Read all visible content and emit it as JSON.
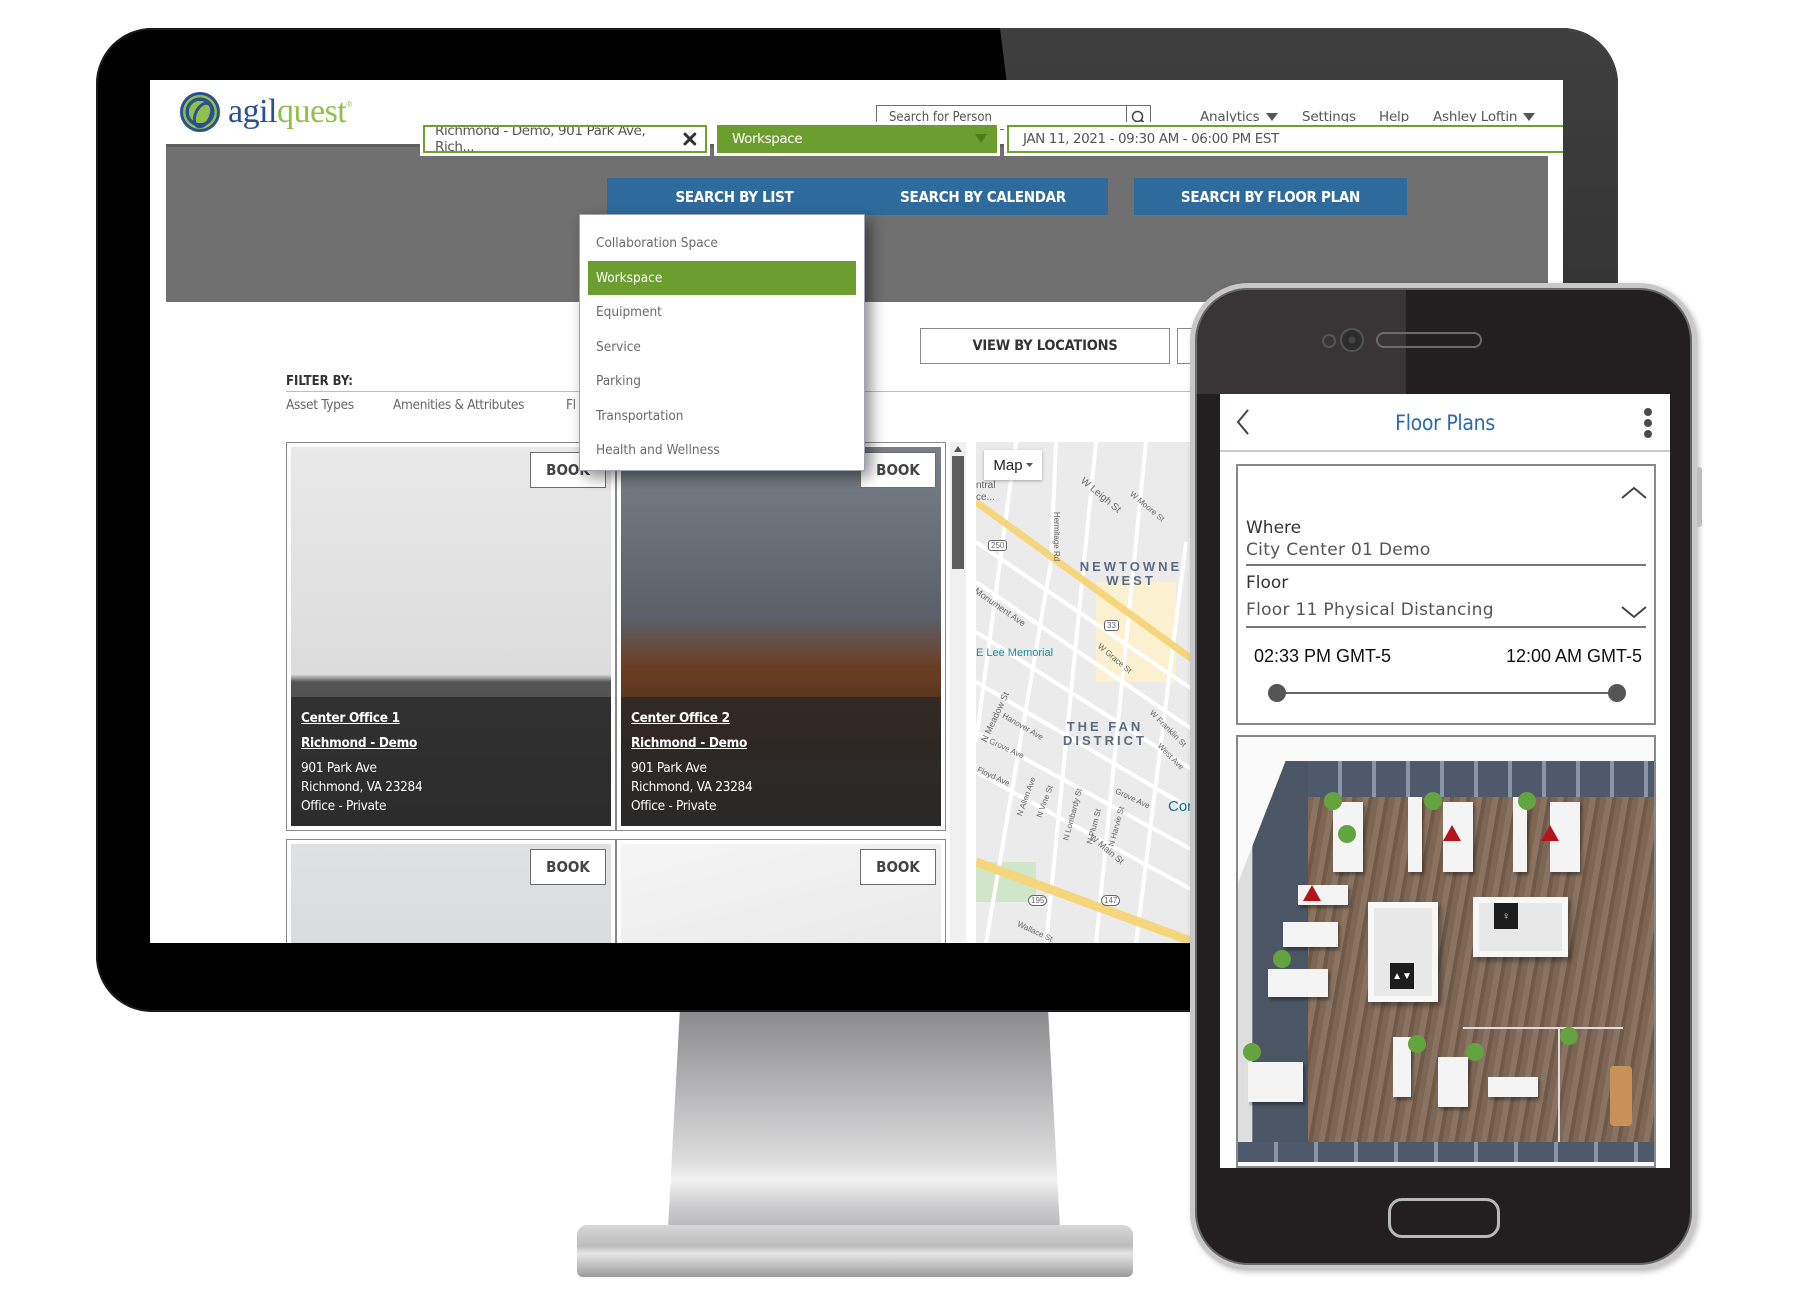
{
  "desktop_app": {
    "brand": {
      "logo_part1": "agil",
      "logo_part2": "quest",
      "logo_mark": "®"
    },
    "header": {
      "search_placeholder": "Search for Person",
      "nav": [
        {
          "label": "Analytics",
          "has_dropdown": true
        },
        {
          "label": "Settings",
          "has_dropdown": false
        },
        {
          "label": "Help",
          "has_dropdown": false
        },
        {
          "label": "Ashley Loftin",
          "has_dropdown": true
        }
      ]
    },
    "search": {
      "location_value": "Richmond - Demo, 901 Park Ave, Rich...",
      "type_value": "Workspace",
      "date_value": "JAN 11, 2021 - 09:30 AM - 06:00 PM EST",
      "buttons": [
        {
          "label": "SEARCH BY LIST"
        },
        {
          "label": "SEARCH BY CALENDAR"
        },
        {
          "label": "SEARCH BY FLOOR PLAN"
        }
      ],
      "type_options": [
        {
          "label": "Collaboration Space",
          "selected": false
        },
        {
          "label": "Workspace",
          "selected": true
        },
        {
          "label": "Equipment",
          "selected": false
        },
        {
          "label": "Service",
          "selected": false
        },
        {
          "label": "Parking",
          "selected": false
        },
        {
          "label": "Transportation",
          "selected": false
        },
        {
          "label": "Health and Wellness",
          "selected": false
        }
      ]
    },
    "view_toggle": {
      "view_by_locations": "VIEW BY LOCATIONS"
    },
    "filters": {
      "label": "FILTER BY:",
      "tabs": [
        "Asset Types",
        "Amenities & Attributes",
        "Fl"
      ]
    },
    "results": [
      {
        "name": "Center Office 1",
        "location": "Richmond - Demo",
        "address": "901 Park Ave",
        "city": "Richmond, VA 23284",
        "type": "Office - Private",
        "book_label": "BOOK"
      },
      {
        "name": "Center Office 2",
        "location": "Richmond - Demo",
        "address": "901 Park Ave",
        "city": "Richmond, VA 23284",
        "type": "Office - Private",
        "book_label": "BOOK"
      },
      {
        "book_label": "BOOK"
      },
      {
        "book_label": "BOOK"
      }
    ],
    "map": {
      "type_button": "Map",
      "labels": [
        "ntral",
        "ce...",
        "W Leigh St",
        "W Moore St",
        "Hermitage Rd",
        "250",
        "Monument Ave",
        "33",
        "E Lee Memorial",
        "W Grace St",
        "N Meadow St",
        "Hanover Ave",
        "Grove Ave",
        "W Franklin St",
        "West Ave",
        "Floyd Ave",
        "N Allen Ave",
        "N Vine St",
        "N Lombardy St",
        "N Plum St",
        "N Harvie St",
        "Grove Ave",
        "W Main St",
        "195",
        "147",
        "Wallace St",
        "Cor"
      ],
      "districts": [
        "NEWTOWNE WEST",
        "THE FAN DISTRICT"
      ]
    }
  },
  "mobile_app": {
    "title": "Floor Plans",
    "where_label": "Where",
    "where_value": "City Center 01 Demo",
    "floor_label": "Floor",
    "floor_value": "Floor 11 Physical Distancing",
    "time_start": "02:33 PM GMT-5",
    "time_end": "12:00 AM GMT-5",
    "floor_plan": {
      "available_marker_color": "#63a340",
      "unavailable_marker_color": "#b3151b",
      "available_count": 11,
      "unavailable_count": 3,
      "signs": [
        "ELEVATOR",
        "WOMEN"
      ]
    }
  },
  "colors": {
    "brand_green": "#6b9e2f",
    "button_blue": "#2f6a9c",
    "title_blue": "#2a69b0",
    "band_gray": "#707070"
  }
}
